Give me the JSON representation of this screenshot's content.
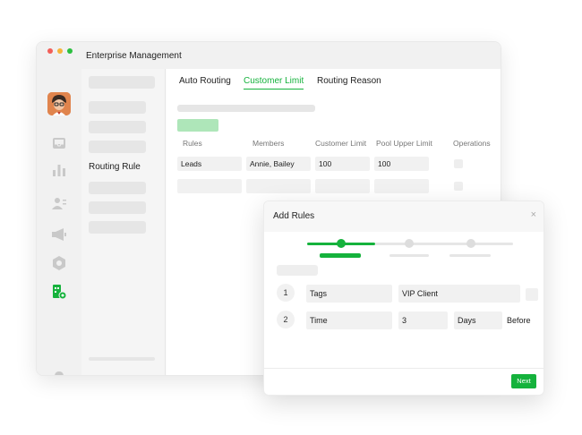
{
  "window": {
    "title": "Enterprise Management"
  },
  "sidebar": {
    "icons": [
      "inbox-icon",
      "bar-chart-icon",
      "contacts-icon",
      "megaphone-icon",
      "settings-icon",
      "routing-icon",
      "bell-icon"
    ],
    "list_label": "Routing Rule"
  },
  "tabs": [
    {
      "label": "Auto Routing"
    },
    {
      "label": "Customer Limit",
      "active": true
    },
    {
      "label": "Routing Reason"
    }
  ],
  "table": {
    "headers": [
      "Rules",
      "Members",
      "Customer Limit",
      "Pool Upper Limit",
      "Operations"
    ],
    "rows": [
      {
        "rules": "Leads",
        "members": "Annie, Bailey",
        "customer_limit": "100",
        "pool_upper_limit": "100"
      }
    ]
  },
  "dialog": {
    "title": "Add Rules",
    "close": "×",
    "steps": {
      "total": 3,
      "current": 1
    },
    "rules": [
      {
        "num": "1",
        "field": "Tags",
        "value": "VIP Client"
      },
      {
        "num": "2",
        "field": "Time",
        "value": "3",
        "unit": "Days",
        "suffix": "Before"
      }
    ],
    "next_label": "Next"
  },
  "colors": {
    "accent": "#15b23c",
    "accent_light": "#aee6b9",
    "placeholder": "#e6e6e6"
  }
}
